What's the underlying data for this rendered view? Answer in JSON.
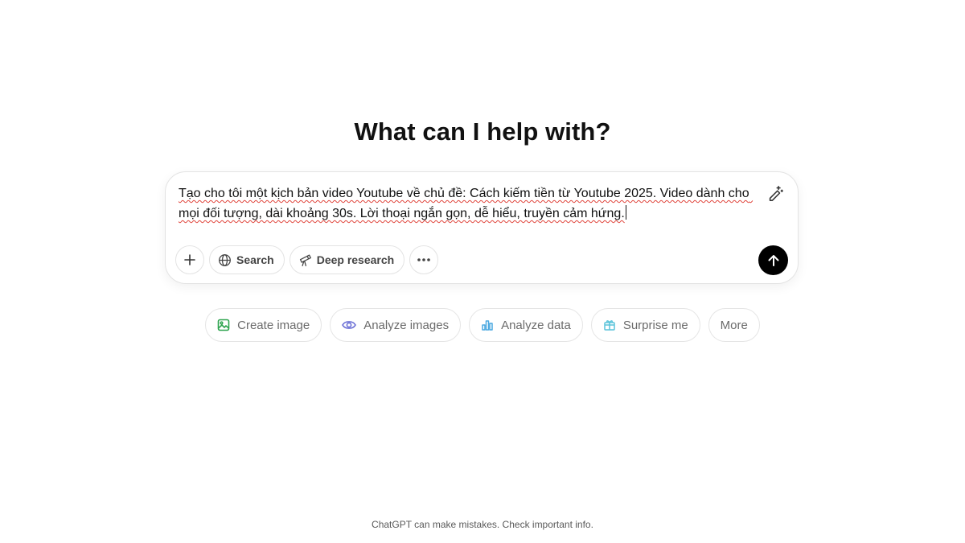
{
  "main": {
    "heading": "What can I help with?"
  },
  "composer": {
    "text": "Tạo cho tôi một kịch bản video Youtube về chủ đề: Cách kiếm tiền từ Youtube 2025. Video dành cho mọi đối tượng, dài khoảng 30s. Lời thoại ngắn gọn, dễ hiểu, truyền cảm hứng.",
    "tools": {
      "search_label": "Search",
      "deep_research_label": "Deep research"
    }
  },
  "suggestions": [
    {
      "label": "Create image",
      "icon": "image-icon",
      "color": "#2ea44f"
    },
    {
      "label": "Analyze images",
      "icon": "eye-icon",
      "color": "#6b6fd6"
    },
    {
      "label": "Analyze data",
      "icon": "bar-chart-icon",
      "color": "#4aa8e0"
    },
    {
      "label": "Surprise me",
      "icon": "gift-icon",
      "color": "#5bc4da"
    },
    {
      "label": "More",
      "icon": "",
      "color": "#6b6b6b"
    }
  ],
  "footer": {
    "disclaimer": "ChatGPT can make mistakes. Check important info."
  }
}
